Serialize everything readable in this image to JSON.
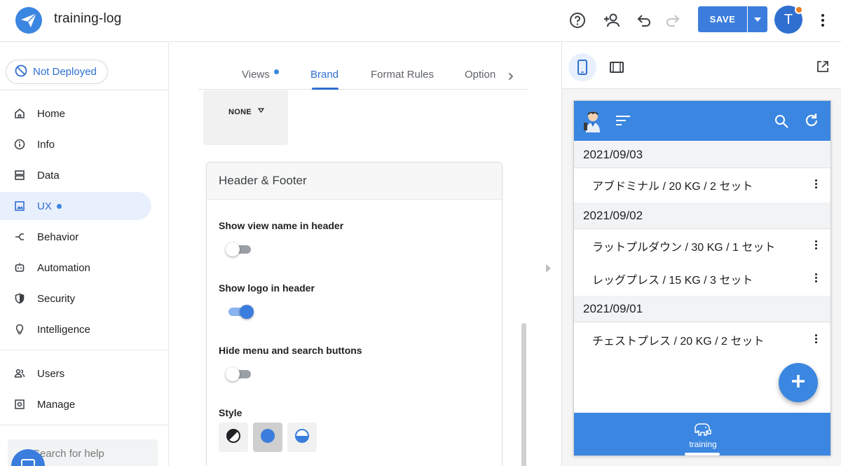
{
  "app": {
    "title": "training-log",
    "accent_color": "#3b86e0",
    "save_label": "SAVE",
    "avatar_letter": "T"
  },
  "toolbar_icons": [
    "help-icon",
    "add-person-icon",
    "undo-icon",
    "redo-icon",
    "save-dropdown-icon",
    "more-vert-icon"
  ],
  "sidebar": {
    "deploy_status": "Not Deployed",
    "items": [
      {
        "label": "Home",
        "icon": "home-icon"
      },
      {
        "label": "Info",
        "icon": "info-icon"
      },
      {
        "label": "Data",
        "icon": "data-icon"
      },
      {
        "label": "UX",
        "icon": "ux-icon",
        "active": true
      },
      {
        "label": "Behavior",
        "icon": "behavior-icon"
      },
      {
        "label": "Automation",
        "icon": "automation-icon"
      },
      {
        "label": "Security",
        "icon": "shield-icon"
      },
      {
        "label": "Intelligence",
        "icon": "lightbulb-icon"
      },
      {
        "label": "Users",
        "icon": "users-icon"
      },
      {
        "label": "Manage",
        "icon": "manage-icon"
      }
    ],
    "help_placeholder": "Search for help"
  },
  "tabs": [
    {
      "label": "Views"
    },
    {
      "label": "Brand",
      "active": true
    },
    {
      "label": "Format Rules"
    },
    {
      "label": "Option"
    }
  ],
  "none_select": {
    "label": "NONE"
  },
  "header_footer": {
    "title": "Header & Footer",
    "fields": [
      {
        "label": "Show view name in header",
        "on": false
      },
      {
        "label": "Show logo in header",
        "on": true
      },
      {
        "label": "Hide menu and search buttons",
        "on": false
      }
    ],
    "style_label": "Style"
  },
  "preview": {
    "groups": [
      {
        "date": "2021/09/03",
        "items": [
          "アブドミナル / 20 KG / 2 セット"
        ]
      },
      {
        "date": "2021/09/02",
        "items": [
          "ラットプルダウン / 30 KG / 1 セット",
          "レッグプレス / 15 KG / 3 セット"
        ]
      },
      {
        "date": "2021/09/01",
        "items": [
          "チェストプレス / 20 KG / 2 セット"
        ]
      }
    ],
    "bottom_nav_label": "training"
  }
}
